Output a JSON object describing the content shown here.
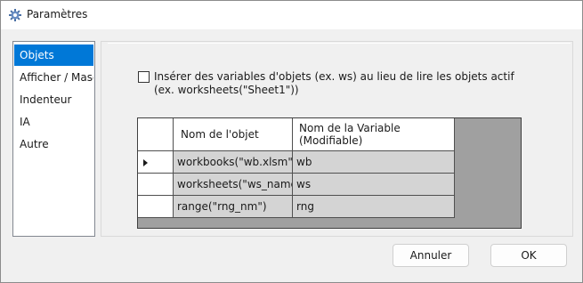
{
  "window": {
    "title": "Paramètres",
    "icon": "gear-icon"
  },
  "nav": {
    "items": [
      {
        "label": "Objets",
        "selected": true
      },
      {
        "label": "Afficher / Masquer",
        "selected": false
      },
      {
        "label": "Indenteur",
        "selected": false
      },
      {
        "label": "IA",
        "selected": false
      },
      {
        "label": "Autre",
        "selected": false
      }
    ]
  },
  "option": {
    "checked": false,
    "line1": "Insérer des variables d'objets (ex. ws) au lieu de lire les objets actif",
    "line2": "(ex. worksheets(\"Sheet1\"))"
  },
  "grid": {
    "columns": [
      "Nom de l'objet",
      "Nom de la Variable",
      "(Modifiable)"
    ],
    "rows": [
      {
        "current": true,
        "object": "workbooks(\"wb.xlsm\")",
        "variable": "wb"
      },
      {
        "current": false,
        "object": "worksheets(\"ws_name\")",
        "variable": "ws"
      },
      {
        "current": false,
        "object": "range(\"rng_nm\")",
        "variable": "rng"
      }
    ]
  },
  "buttons": {
    "cancel": "Annuler",
    "ok": "OK"
  }
}
